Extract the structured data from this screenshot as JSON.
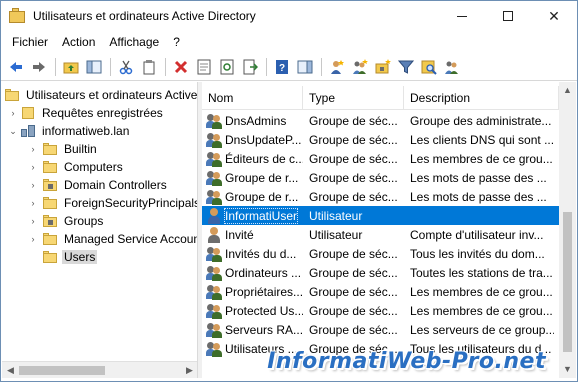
{
  "window": {
    "title": "Utilisateurs et ordinateurs Active Directory"
  },
  "menu": [
    "Fichier",
    "Action",
    "Affichage",
    "?"
  ],
  "toolbar": [
    "back-arrow-icon",
    "forward-arrow-icon",
    "folder-up-icon",
    "console-tree-icon",
    "cut-icon",
    "copy-icon",
    "delete-icon",
    "properties-icon",
    "refresh-icon",
    "export-list-icon",
    "help-icon",
    "action-pane-icon",
    "new-user-icon",
    "new-group-icon",
    "new-ou-icon",
    "filter-icon",
    "find-icon",
    "add-to-group-icon"
  ],
  "tree": {
    "root": "Utilisateurs et ordinateurs Active Directory",
    "saved_queries": "Requêtes enregistrées",
    "domain": "informatiweb.lan",
    "children": [
      "Builtin",
      "Computers",
      "Domain Controllers",
      "ForeignSecurityPrincipals",
      "Groups",
      "Managed Service Accounts",
      "Users"
    ],
    "selected": "Users"
  },
  "list": {
    "columns": [
      "Nom",
      "Type",
      "Description"
    ],
    "rows": [
      {
        "name": "DnsAdmins",
        "type": "Groupe de séc...",
        "desc": "Groupe des administrate...",
        "icon": "group"
      },
      {
        "name": "DnsUpdateP...",
        "type": "Groupe de séc...",
        "desc": "Les clients DNS qui sont ...",
        "icon": "group"
      },
      {
        "name": "Éditeurs de c...",
        "type": "Groupe de séc...",
        "desc": "Les membres de ce grou...",
        "icon": "group"
      },
      {
        "name": "Groupe de r...",
        "type": "Groupe de séc...",
        "desc": "Les mots de passe des ...",
        "icon": "group"
      },
      {
        "name": "Groupe de r...",
        "type": "Groupe de séc...",
        "desc": "Les mots de passe des ...",
        "icon": "group"
      },
      {
        "name": "InformatiUser",
        "type": "Utilisateur",
        "desc": "",
        "icon": "user",
        "selected": true
      },
      {
        "name": "Invité",
        "type": "Utilisateur",
        "desc": "Compte d'utilisateur inv...",
        "icon": "guest"
      },
      {
        "name": "Invités du d...",
        "type": "Groupe de séc...",
        "desc": "Tous les invités du dom...",
        "icon": "group"
      },
      {
        "name": "Ordinateurs ...",
        "type": "Groupe de séc...",
        "desc": "Toutes les stations de tra...",
        "icon": "group"
      },
      {
        "name": "Propriétaires...",
        "type": "Groupe de séc...",
        "desc": "Les membres de ce grou...",
        "icon": "group"
      },
      {
        "name": "Protected Us...",
        "type": "Groupe de séc...",
        "desc": "Les membres de ce grou...",
        "icon": "group"
      },
      {
        "name": "Serveurs RA...",
        "type": "Groupe de séc...",
        "desc": "Les serveurs de ce group...",
        "icon": "group"
      },
      {
        "name": "Utilisateurs ...",
        "type": "Groupe de séc...",
        "desc": "Tous les utilisateurs du d...",
        "icon": "group"
      }
    ]
  },
  "watermark": "InformatiWeb-Pro.net",
  "colors": {
    "selection": "#0078d7",
    "watermark": "#2a6fc2"
  }
}
